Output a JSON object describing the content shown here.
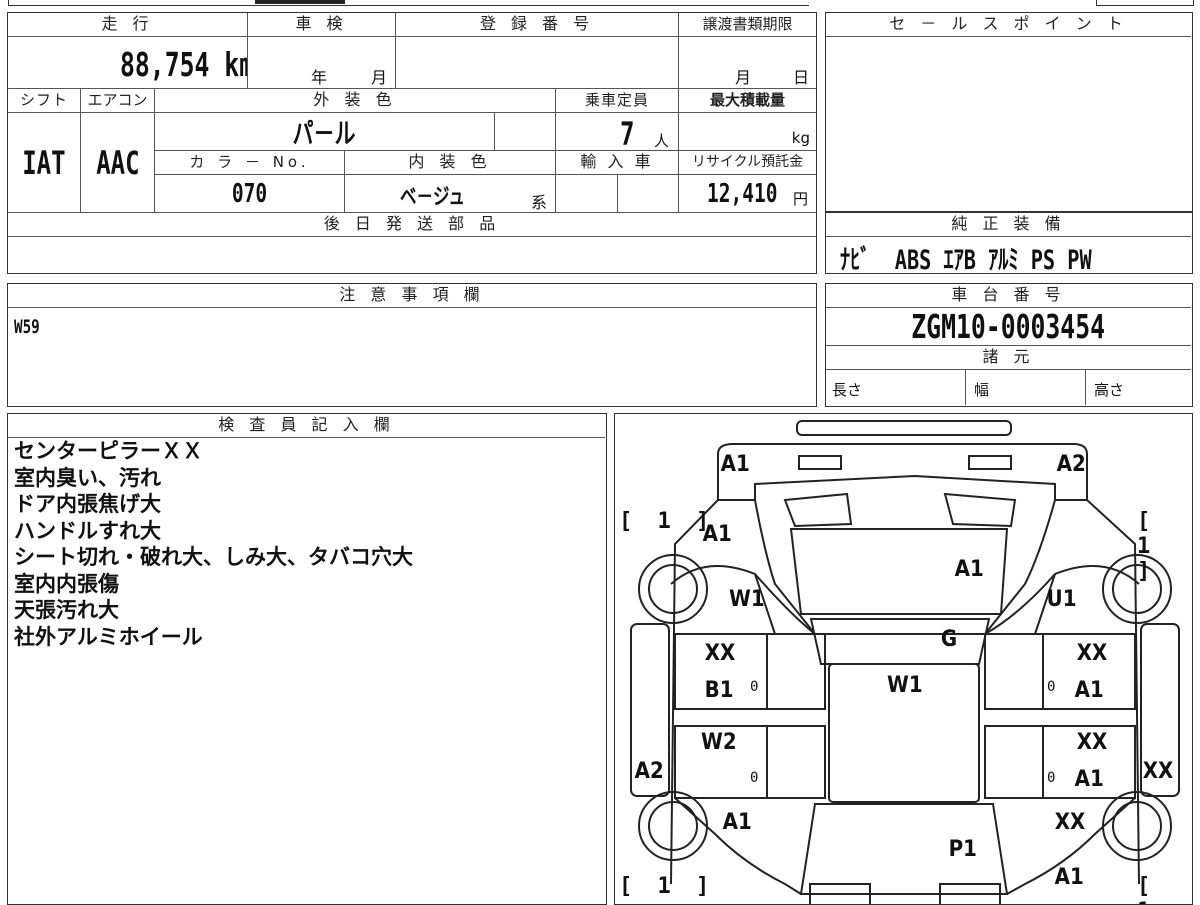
{
  "main_info": {
    "mileage_header": "走 行",
    "mileage_value": "88,754 km",
    "inspection_header": "車 検",
    "inspection_year": "年",
    "inspection_month": "月",
    "registration_header": "登 録 番 号",
    "transfer_header": "譲渡書類期限",
    "transfer_month": "月",
    "transfer_day": "日",
    "shift_header": "シフト",
    "shift_value": "IAT",
    "aircon_header": "エアコン",
    "aircon_value": "AAC",
    "exterior_header": "外 装 色",
    "exterior_value": "パ－ル",
    "capacity_header": "乗車定員",
    "capacity_value": "7",
    "capacity_unit": "人",
    "maxload_header": "最大積載量",
    "maxload_unit": "kg",
    "colorno_header": "カ ラ － No.",
    "colorno_value": "070",
    "interior_header": "内 装 色",
    "interior_value": "ベ－ジュ",
    "interior_suffix": "系",
    "import_header": "輸 入 車",
    "recycle_header": "リサイクル預託金",
    "recycle_value": "12,410",
    "recycle_unit": "円",
    "parts_header": "後 日 発 送 部 品"
  },
  "sales_point": {
    "header": "セ － ル ス ポ イ ン ト"
  },
  "genuine_equipment": {
    "header": "純 正 装 備",
    "value": "ﾅﾋﾞ  ABS ｴｱB ｱﾙﾐ PS PW"
  },
  "notes": {
    "header": "注 意 事 項 欄",
    "value": "W59"
  },
  "chassis": {
    "header": "車 台 番 号",
    "value": "ZGM10-0003454",
    "specs_header": "諸 元",
    "length_label": "長さ",
    "width_label": "幅",
    "height_label": "高さ"
  },
  "inspector": {
    "header": "検 査 員 記 入 欄",
    "lines": [
      "センターピラーＸＸ",
      "室内臭い、汚れ",
      "ドア内張焦げ大",
      "ハンドルすれ大",
      "シート切れ・破れ大、しみ大、タバコ穴大",
      "室内内張傷",
      "天張汚れ大",
      "社外アルミホイール"
    ]
  },
  "diagram": {
    "bracket": "[ 1 ]",
    "zero": "0",
    "labels": {
      "top_left": "A1",
      "top_right": "A2",
      "hood_left": "A1",
      "windshield": "A1",
      "fender_left": "W1",
      "fender_right": "U1",
      "cowl": "G",
      "front_door_left_top": "XX",
      "front_door_left_bottom": "B1",
      "roof": "W1",
      "front_door_right_top": "XX",
      "front_door_right_bottom": "A1",
      "rear_door_left": "W2",
      "rocker_left": "A2",
      "rear_door_right_top": "XX",
      "rear_door_right_bottom": "A1",
      "pillar_right": "XX",
      "quarter_left": "A1",
      "quarter_right": "XX",
      "rear_glass": "P1",
      "rear_right": "A1"
    }
  }
}
